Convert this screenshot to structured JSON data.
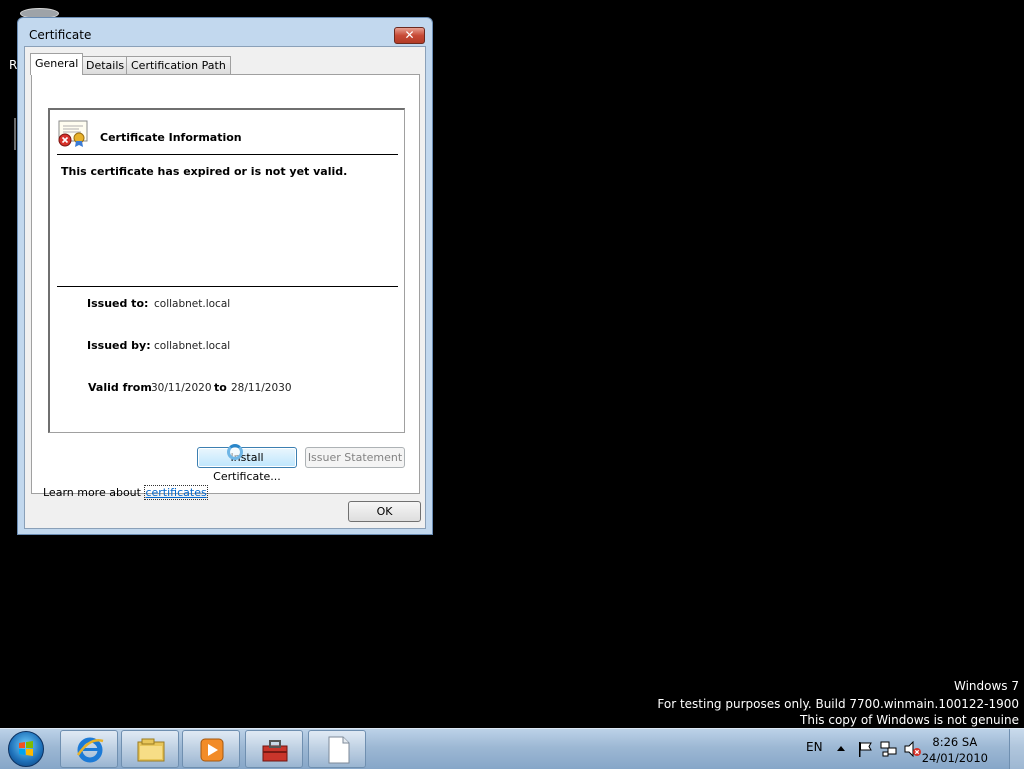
{
  "desktop": {
    "partial_label": "R"
  },
  "dialog": {
    "title": "Certificate",
    "close_label": "✕",
    "tabs": [
      {
        "label": "General",
        "active": true
      },
      {
        "label": "Details",
        "active": false
      },
      {
        "label": "Certification Path",
        "active": false
      }
    ],
    "heading": "Certificate Information",
    "status_message": "This certificate has expired or is not yet valid.",
    "issued_to_label": "Issued to:",
    "issued_to_value": "collabnet.local",
    "issued_by_label": "Issued by:",
    "issued_by_value": "collabnet.local",
    "valid_from_label": "Valid from",
    "valid_from_value": "30/11/2020",
    "valid_to_label": "to",
    "valid_to_value": "28/11/2030",
    "install_button": "Install Certificate...",
    "issuer_statement_button": "Issuer Statement",
    "learn_more_prefix": "Learn more about",
    "learn_more_link": "certificates",
    "ok_button": "OK"
  },
  "watermark": {
    "line1": "Windows 7",
    "line2": "For testing purposes only. Build 7700.winmain.100122-1900",
    "line3": "This copy of Windows is not genuine"
  },
  "taskbar": {
    "pinned": [
      "internet-explorer-icon",
      "windows-explorer-icon",
      "media-player-icon",
      "toolbox-icon",
      "blank-document-icon"
    ],
    "language": "EN",
    "time": "8:26 SA",
    "date": "24/01/2010"
  },
  "colors": {
    "window_frame": "#c2d8ee",
    "desktop": "#000000",
    "taskbar": "#9db8d4",
    "link": "#0066cc"
  }
}
